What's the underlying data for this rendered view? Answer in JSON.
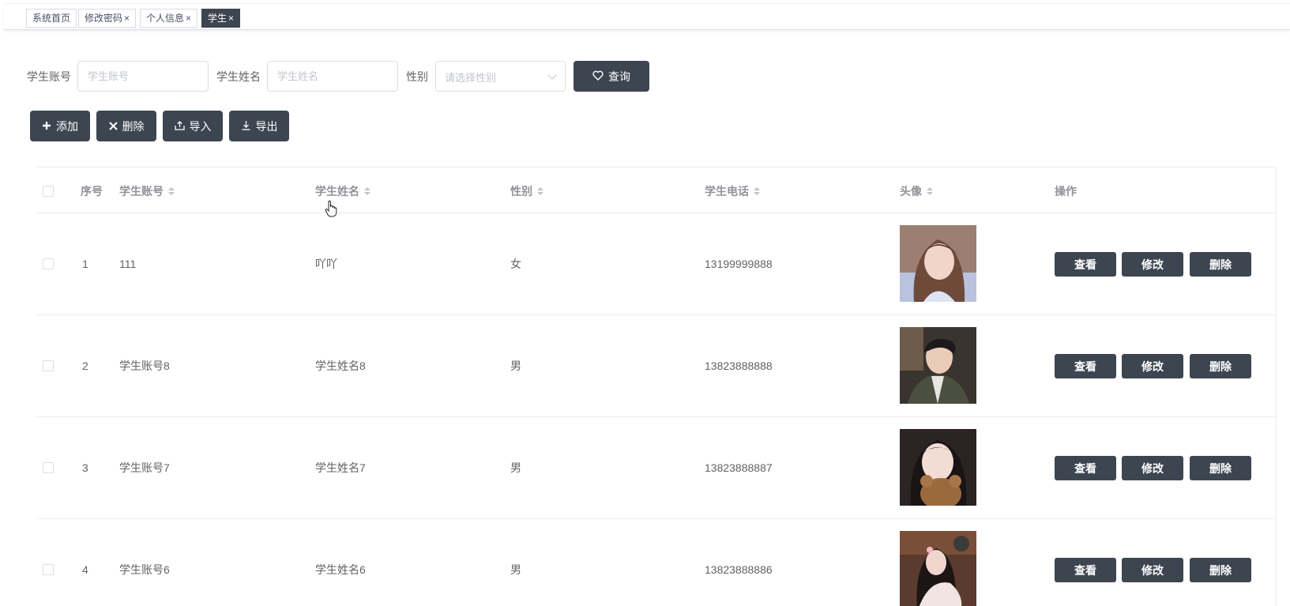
{
  "tags": [
    {
      "label": "系统首页",
      "closable": false,
      "active": false
    },
    {
      "label": "修改密码",
      "closable": true,
      "active": false
    },
    {
      "label": "个人信息",
      "closable": true,
      "active": false
    },
    {
      "label": "学生",
      "closable": true,
      "active": true
    }
  ],
  "tag_close_glyph": "×",
  "search": {
    "account_label": "学生账号",
    "account_placeholder": "学生账号",
    "name_label": "学生姓名",
    "name_placeholder": "学生姓名",
    "gender_label": "性别",
    "gender_placeholder": "请选择性别",
    "query_label": "查询"
  },
  "toolbar": {
    "add_label": "添加",
    "delete_label": "删除",
    "import_label": "导入",
    "export_label": "导出"
  },
  "table": {
    "headers": {
      "index": "序号",
      "account": "学生账号",
      "name": "学生姓名",
      "gender": "性别",
      "phone": "学生电话",
      "avatar": "头像",
      "actions": "操作"
    },
    "rows": [
      {
        "index": "1",
        "account": "111",
        "name": "吖吖",
        "gender": "女",
        "phone": "13199999888",
        "avatar": "avatar-photo-1"
      },
      {
        "index": "2",
        "account": "学生账号8",
        "name": "学生姓名8",
        "gender": "男",
        "phone": "13823888888",
        "avatar": "avatar-photo-2"
      },
      {
        "index": "3",
        "account": "学生账号7",
        "name": "学生姓名7",
        "gender": "男",
        "phone": "13823888887",
        "avatar": "avatar-photo-3"
      },
      {
        "index": "4",
        "account": "学生账号6",
        "name": "学生姓名6",
        "gender": "男",
        "phone": "13823888886",
        "avatar": "avatar-photo-4"
      }
    ],
    "row_actions": {
      "view": "查看",
      "edit": "修改",
      "delete": "删除"
    }
  },
  "colors": {
    "primary_dark": "#3d4550",
    "border": "#dcdfe6",
    "header_text": "#909399",
    "cell_text": "#606266"
  },
  "icons": {
    "query": "heart-icon",
    "add": "plus-icon",
    "delete": "close-icon",
    "import": "upload-icon",
    "export": "download-icon",
    "sort": "sort-caret-icon"
  }
}
